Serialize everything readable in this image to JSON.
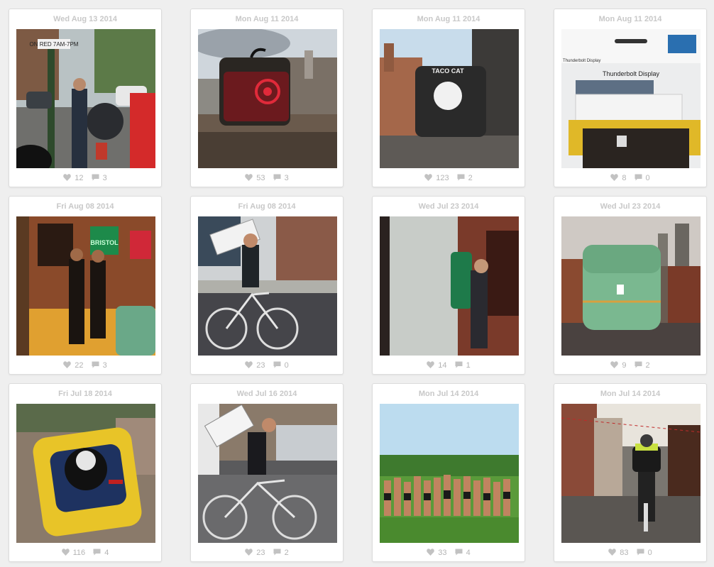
{
  "icons": {
    "like": "heart-icon",
    "comment": "comment-bubble-icon"
  },
  "colors": {
    "page_background": "#efefef",
    "card_background": "#ffffff",
    "meta_text": "#b4b4b4",
    "date_text": "#c8c8c8"
  },
  "posts": [
    {
      "date": "Wed Aug 13 2014",
      "likes": "12",
      "comments": "3",
      "sign_text": "ON RED 7AM-7PM"
    },
    {
      "date": "Mon Aug 11 2014",
      "likes": "53",
      "comments": "3"
    },
    {
      "date": "Mon Aug 11 2014",
      "likes": "123",
      "comments": "2",
      "bag_text": "TACO CAT"
    },
    {
      "date": "Mon Aug 11 2014",
      "likes": "8",
      "comments": "0",
      "box_text": "Thunderbolt Display",
      "box_text_2": "Thunderbolt Display"
    },
    {
      "date": "Fri Aug 08 2014",
      "likes": "22",
      "comments": "3",
      "sign_text": "BRISTOL"
    },
    {
      "date": "Fri Aug 08 2014",
      "likes": "23",
      "comments": "0"
    },
    {
      "date": "Wed Jul 23 2014",
      "likes": "14",
      "comments": "1"
    },
    {
      "date": "Wed Jul 23 2014",
      "likes": "9",
      "comments": "2"
    },
    {
      "date": "Fri Jul 18 2014",
      "likes": "116",
      "comments": "4"
    },
    {
      "date": "Wed Jul 16 2014",
      "likes": "23",
      "comments": "2"
    },
    {
      "date": "Mon Jul 14 2014",
      "likes": "33",
      "comments": "4"
    },
    {
      "date": "Mon Jul 14 2014",
      "likes": "83",
      "comments": "0"
    }
  ]
}
